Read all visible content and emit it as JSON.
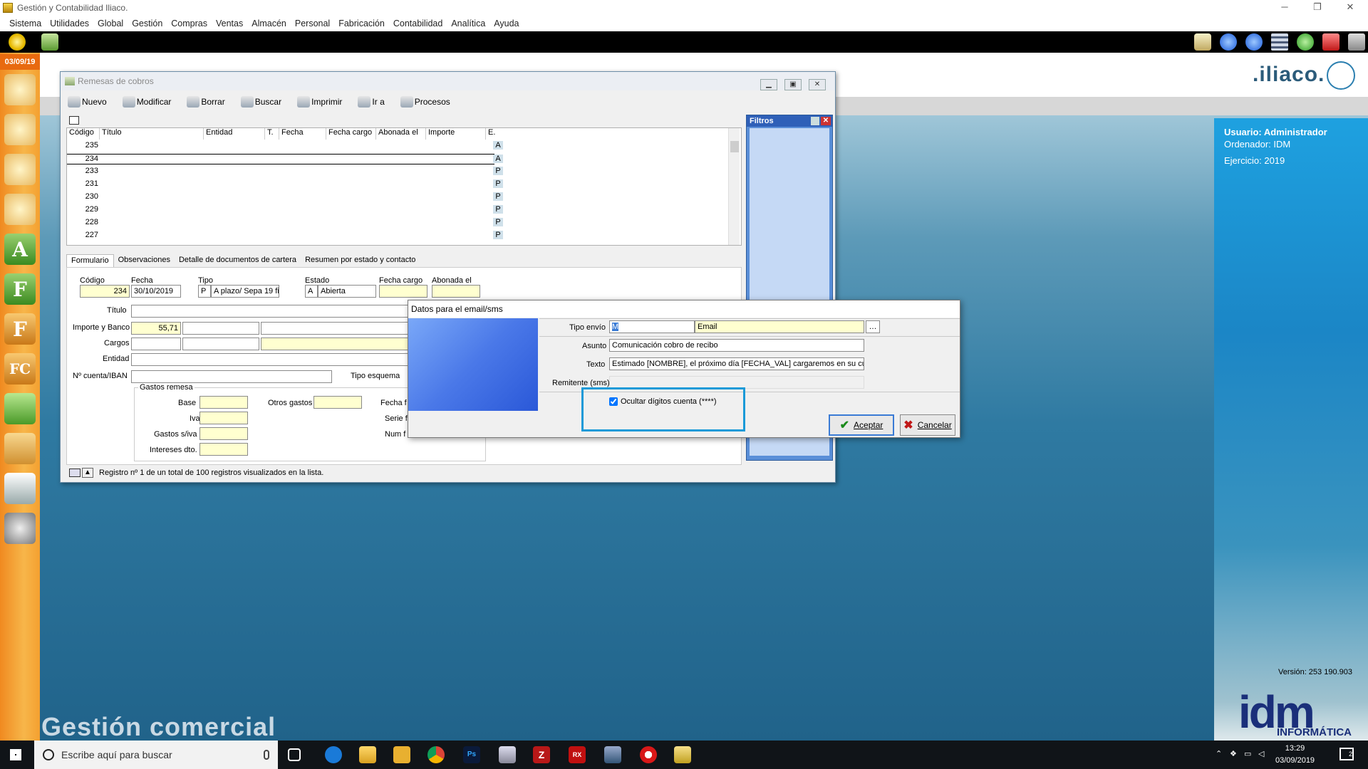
{
  "window": {
    "title": "Gestión y Contabilidad Iliaco."
  },
  "menu": [
    "Sistema",
    "Utilidades",
    "Global",
    "Gestión",
    "Compras",
    "Ventas",
    "Almacén",
    "Personal",
    "Fabricación",
    "Contabilidad",
    "Analítica",
    "Ayuda"
  ],
  "sidebar": {
    "date": "03/09/19",
    "letters": [
      "A",
      "F",
      "F",
      "FC"
    ]
  },
  "brand": {
    "logo": ".iliaco.",
    "footer": "Gestión comercial",
    "version": "Versión: 253 190.903",
    "idm": "idm",
    "idm_sub": "INFORMÁTICA"
  },
  "user_info": {
    "usuario": "Usuario: Administrador",
    "ordenador": "Ordenador: IDM",
    "ejercicio": "Ejercicio: 2019"
  },
  "remesas": {
    "title": "Remesas de cobros",
    "toolbar": {
      "nuevo": "Nuevo",
      "modificar": "Modificar",
      "borrar": "Borrar",
      "buscar": "Buscar",
      "imprimir": "Imprimir",
      "ir_a": "Ir a",
      "procesos": "Procesos"
    },
    "columns": [
      "Código",
      "Título",
      "Entidad",
      "T.",
      "Fecha",
      "Fecha cargo",
      "Abonada el",
      "Importe",
      "E."
    ],
    "rows": [
      {
        "code": "235",
        "e": "A"
      },
      {
        "code": "234",
        "e": "A"
      },
      {
        "code": "233",
        "e": "P"
      },
      {
        "code": "231",
        "e": "P"
      },
      {
        "code": "230",
        "e": "P"
      },
      {
        "code": "229",
        "e": "P"
      },
      {
        "code": "228",
        "e": "P"
      },
      {
        "code": "227",
        "e": "P"
      }
    ],
    "tabs": [
      "Formulario",
      "Observaciones",
      "Detalle de documentos de cartera",
      "Resumen por estado y contacto"
    ],
    "form": {
      "codigo_label": "Código",
      "codigo": "234",
      "fecha_label": "Fecha",
      "fecha": "30/10/2019",
      "tipo_label": "Tipo",
      "tipo_code": "P",
      "tipo": "A plazo/ Sepa 19 fi",
      "estado_label": "Estado",
      "estado_code": "A",
      "estado": "Abierta",
      "fecha_cargo_label": "Fecha cargo",
      "abonada_label": "Abonada el",
      "titulo_label": "Título",
      "importe_label": "Importe y Banco",
      "importe": "55,71",
      "cargos_label": "Cargos",
      "entidad_label": "Entidad",
      "iban_label": "Nº cuenta/IBAN",
      "tipo_esquema_label": "Tipo esquema",
      "gastos_label": "Gastos remesa",
      "base_label": "Base",
      "iva_label": "Iva",
      "gastos_siva_label": "Gastos s/iva",
      "intereses_label": "Intereses dto.",
      "otros_gastos_label": "Otros gastos",
      "fecha_f_label": "Fecha f",
      "serie_label": "Serie f",
      "num_label": "Num f"
    },
    "status": "Registro nº 1 de un total de 100 registros visualizados en la lista."
  },
  "filtros": {
    "title": "Filtros"
  },
  "dialog": {
    "title": "Datos para el email/sms",
    "tipo_envio_label": "Tipo envío",
    "tipo_envio_code": "M",
    "tipo_envio": "Email",
    "asunto_label": "Asunto",
    "asunto": "Comunicación cobro de recibo",
    "texto_label": "Texto",
    "texto": "Estimado [NOMBRE], el próximo día [FECHA_VAL] cargaremos en su cuen",
    "remitente_label": "Remitente (sms)",
    "ocultar": "Ocultar dígitos cuenta (****)",
    "ocultar_checked": true,
    "aceptar": "Aceptar",
    "cancelar": "Cancelar"
  },
  "taskbar": {
    "search": "Escribe aquí para buscar",
    "time": "13:29",
    "date": "03/09/2019",
    "notif": "2"
  }
}
